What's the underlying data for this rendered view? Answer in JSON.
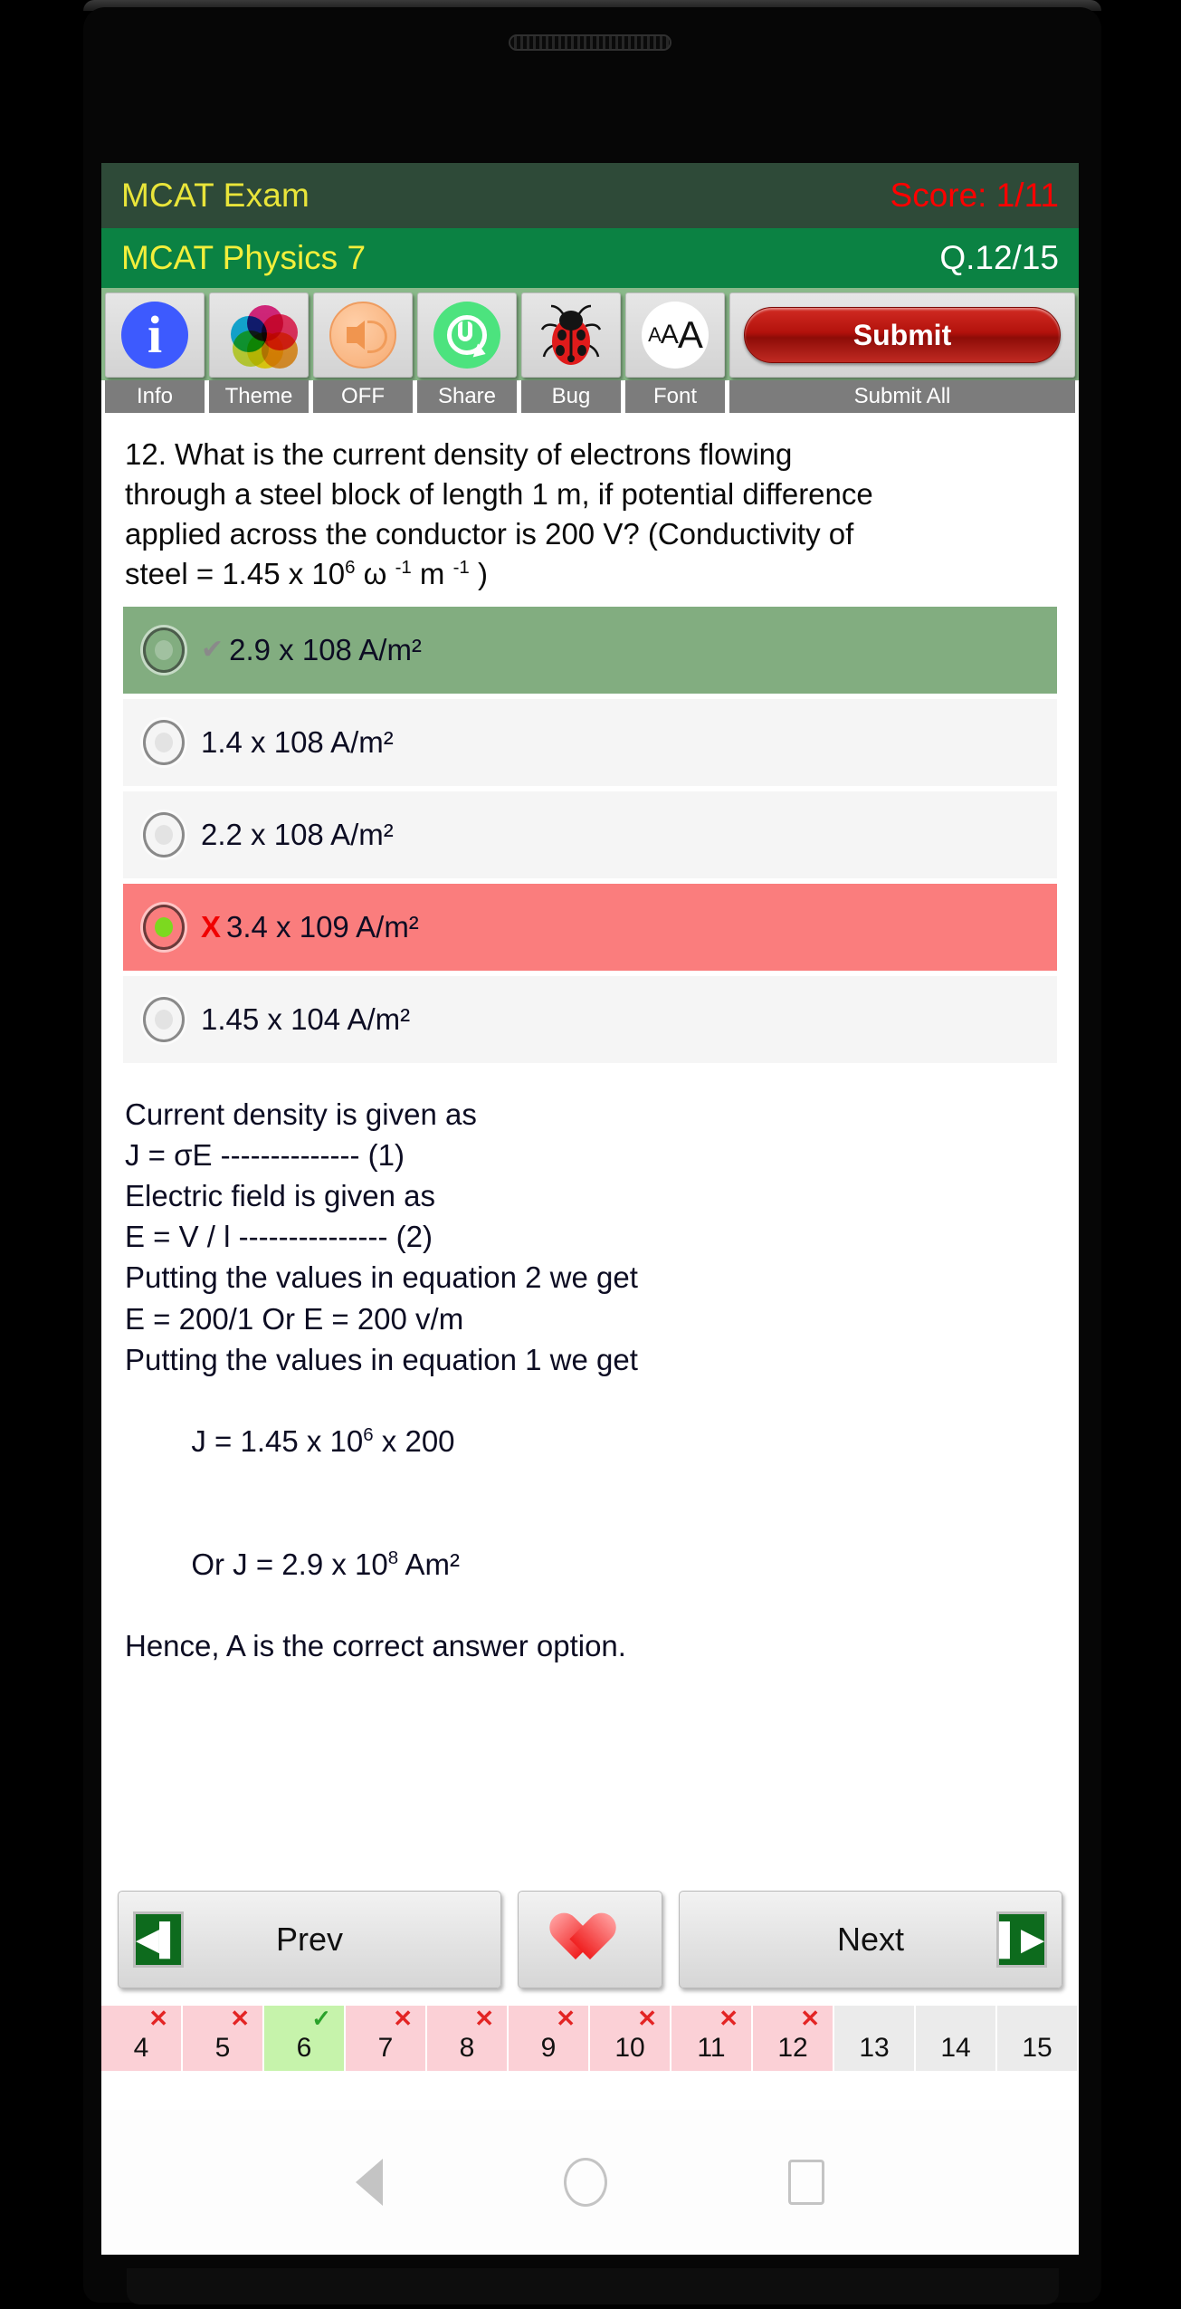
{
  "app": {
    "title": "MCAT Exam",
    "score": "Score: 1/11",
    "subject": "MCAT Physics 7",
    "question_counter": "Q.12/15"
  },
  "toolbar": {
    "buttons": [
      {
        "icon": "info-icon",
        "label": "Info"
      },
      {
        "icon": "palette-icon",
        "label": "Theme"
      },
      {
        "icon": "speaker-icon",
        "label": "OFF"
      },
      {
        "icon": "whatsapp-icon",
        "label": "Share"
      },
      {
        "icon": "ladybug-icon",
        "label": "Bug"
      },
      {
        "icon": "font-size-icon",
        "label": "Font"
      }
    ],
    "submit_label": "Submit",
    "submit_all_label": "Submit All"
  },
  "question": {
    "number": "12.",
    "line1": "12. What is the current density of electrons flowing",
    "line2": "through a steel block of length 1 m, if potential difference",
    "line3": "applied across the conductor is 200 V? (Conductivity of",
    "line4_pre": "steel = 1.45 x 10",
    "line4_sup1": "6",
    "line4_mid": " ω ",
    "line4_sup2": "-1",
    "line4_mid2": " m ",
    "line4_sup3": "-1",
    "line4_end": " )"
  },
  "options": [
    {
      "text": "2.9 x 108 A/m²",
      "state": "correct",
      "marker": "✔",
      "selected": false
    },
    {
      "text": "1.4 x 108 A/m²",
      "state": "neutral",
      "marker": "",
      "selected": false
    },
    {
      "text": "2.2 x 108 A/m²",
      "state": "neutral",
      "marker": "",
      "selected": false
    },
    {
      "text": "3.4 x 109 A/m²",
      "state": "wrong",
      "marker": "X",
      "selected": true
    },
    {
      "text": "1.45 x 104 A/m²",
      "state": "neutral",
      "marker": "",
      "selected": false
    }
  ],
  "explanation": {
    "l1": "Current density is given as",
    "l2": "J = σE -------------- (1)",
    "l3": "Electric field is given as",
    "l4": "E = V / l --------------- (2)",
    "l5": "Putting the values in equation 2 we get",
    "l6": "E = 200/1 Or E = 200 v/m",
    "l7": "Putting the values in equation 1 we get",
    "l8_pre": "J = 1.45 x 10",
    "l8_sup": "6",
    "l8_post": " x 200",
    "l9_pre": "Or J = 2.9 x 10",
    "l9_sup": "8",
    "l9_post": " Am²",
    "l10": "Hence, A is the correct answer option."
  },
  "nav": {
    "prev_label": "Prev",
    "next_label": "Next",
    "favorite_icon": "heart-icon",
    "prev_icon": "skip-back-icon",
    "next_icon": "skip-forward-icon"
  },
  "question_strip": [
    {
      "num": "4",
      "status": "wrong"
    },
    {
      "num": "5",
      "status": "wrong"
    },
    {
      "num": "6",
      "status": "correct"
    },
    {
      "num": "7",
      "status": "wrong"
    },
    {
      "num": "8",
      "status": "wrong"
    },
    {
      "num": "9",
      "status": "wrong"
    },
    {
      "num": "10",
      "status": "wrong"
    },
    {
      "num": "11",
      "status": "wrong"
    },
    {
      "num": "12",
      "status": "wrong"
    },
    {
      "num": "13",
      "status": "unanswered"
    },
    {
      "num": "14",
      "status": "unanswered"
    },
    {
      "num": "15",
      "status": "unanswered"
    }
  ],
  "android_nav": {
    "back": "back-triangle-icon",
    "home": "home-circle-icon",
    "recents": "recents-square-icon"
  },
  "colors": {
    "header_dark": "#2e4a38",
    "header_green": "#0b8243",
    "accent_yellow": "#f3ef3b",
    "score_red": "#ff0000",
    "correct_green": "#82ad80",
    "wrong_red": "#fa7d7d",
    "toolbar_bg": "#8ab98a"
  }
}
